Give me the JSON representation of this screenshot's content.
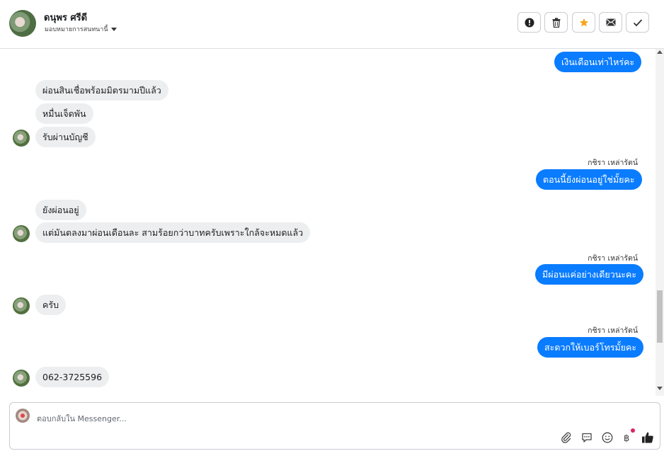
{
  "header": {
    "name": "ดนุพร ศรีดี",
    "assign_label": "มอบหมายการสนทนานี้"
  },
  "toolbar": {
    "buttons": [
      {
        "icon": "alert-icon",
        "label": "!"
      },
      {
        "icon": "trash-icon"
      },
      {
        "icon": "star-icon",
        "color": "#f5a623"
      },
      {
        "icon": "envelope-icon"
      },
      {
        "icon": "check-icon"
      }
    ]
  },
  "messages": [
    {
      "direction": "out",
      "text": "เงินเดือนเท่าไหร่คะ"
    },
    {
      "direction": "in",
      "text": "ผ่อนสินเชื่อพร้อมมิตรมามปีแล้ว"
    },
    {
      "direction": "in",
      "text": "หมื่นเจ็ดพัน"
    },
    {
      "direction": "in",
      "text": "รับผ่านบัญชี"
    },
    {
      "direction": "out",
      "sender": "กชิรา เหล่ารัตน์",
      "text": "ตอนนี้ยังผ่อนอยู่ใช่มั้ยคะ"
    },
    {
      "direction": "in",
      "text": "ยังผ่อนอยู่"
    },
    {
      "direction": "in",
      "text": "แต่มันตลงมาผ่อนเดือนละ สามร้อยกว่าบาทครับเพราะใกล้จะหมดแล้ว"
    },
    {
      "direction": "out",
      "sender": "กชิรา เหล่ารัตน์",
      "text": "มีผ่อนแค่อย่างเดียวนะคะ"
    },
    {
      "direction": "in",
      "text": "ครับ"
    },
    {
      "direction": "out",
      "sender": "กชิรา เหล่ารัตน์",
      "text": "สะดวกให้เบอร์โทรมั้ยคะ"
    },
    {
      "direction": "in",
      "text": "062-3725596"
    }
  ],
  "composer": {
    "placeholder": "ตอบกลับใน Messenger...",
    "icons": [
      "attachment-icon",
      "comment-icon",
      "emoji-icon",
      "baht-icon",
      "thumbs-up-icon"
    ],
    "accent": "#0a7cff",
    "notify_dot_color": "#e0245e"
  }
}
